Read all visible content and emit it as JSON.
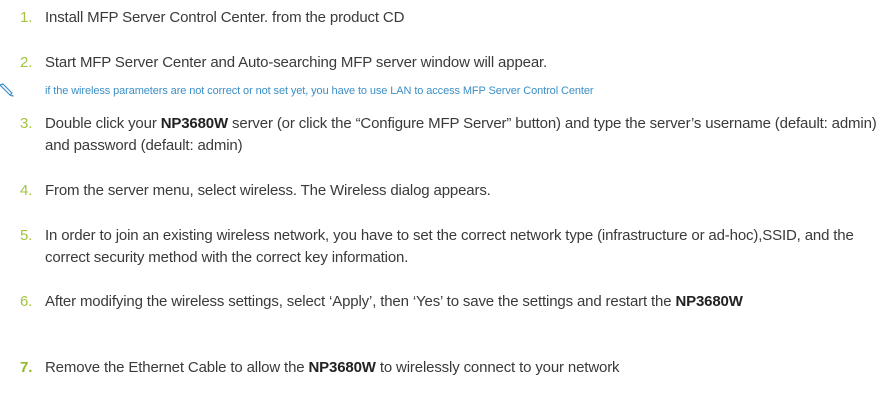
{
  "steps": [
    {
      "number": "1.",
      "text": "Install MFP Server Control Center. from the product CD"
    },
    {
      "number": "2.",
      "text": "Start MFP Server Center and Auto-searching MFP server window will appear."
    },
    {
      "number": "3.",
      "text_a": "Double click your ",
      "bold_a": "NP3680W",
      "text_b": " server (or click the “Configure MFP Server” button) and type the server’s username (default: admin) and password (default: admin)"
    },
    {
      "number": "4.",
      "text": "From the server menu, select wireless. The Wireless dialog appears."
    },
    {
      "number": "5.",
      "text": "In order to join an existing wireless network, you have to set the correct network type (infrastructure or ad-hoc),SSID, and the correct security method with the correct key information."
    },
    {
      "number": "6.",
      "text_a": "After modifying the wireless settings, select ‘Apply’, then ‘Yes’ to save the settings and restart the ",
      "bold_a": "NP3680W"
    },
    {
      "number": "7.",
      "text_a": "Remove the Ethernet Cable to allow the ",
      "bold_a": "NP3680W",
      "text_b": " to wirelessly connect to your network"
    }
  ],
  "note": {
    "icon": "pen-icon",
    "text": "if the wireless parameters are not correct or not set yet, you have to use LAN to access MFP Server Control Center"
  },
  "colors": {
    "step_number": "#a2c440",
    "note_text": "#3b8fc6",
    "body_text": "#3a3a3a"
  }
}
